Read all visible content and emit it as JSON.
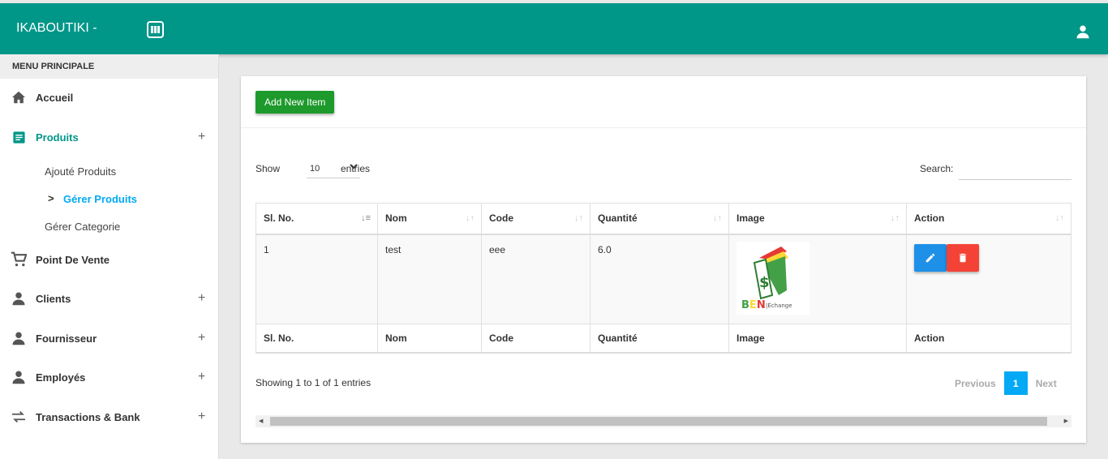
{
  "topbar": {
    "brand": "IKABOUTIKI -",
    "grid_icon": "grid-icon",
    "user_icon": "user-icon",
    "color": "#009688"
  },
  "sidebar": {
    "header": "MENU PRINCIPALE",
    "items": [
      {
        "label": "Accueil",
        "icon": "home-icon"
      },
      {
        "label": "Produits",
        "icon": "document-icon",
        "expand": "+"
      },
      {
        "label": "Point De Vente",
        "icon": "cart-icon"
      },
      {
        "label": "Clients",
        "icon": "person-icon",
        "expand": "+"
      },
      {
        "label": "Fournisseur",
        "icon": "person-icon",
        "expand": "+"
      },
      {
        "label": "Employés",
        "icon": "person-icon",
        "expand": "+"
      },
      {
        "label": "Transactions & Bank",
        "icon": "swap-icon",
        "expand": "+"
      }
    ],
    "subitems": [
      {
        "label": "Ajouté Produits"
      },
      {
        "label": "Gérer Produits",
        "chevron": ">"
      },
      {
        "label": "Gérer Categorie"
      }
    ]
  },
  "card": {
    "add_label": "Add New Item",
    "show_label": "Show",
    "page_size": "10",
    "entries_label": "entries",
    "search_label": "Search:",
    "search_value": "",
    "columns": [
      "Sl. No.",
      "Nom",
      "Code",
      "Quantité",
      "Image",
      "Action"
    ],
    "rows": [
      {
        "sl": "1",
        "nom": "test",
        "code": "eee",
        "quantite": "6.0",
        "image_text": "BEN",
        "image_sub": "Échange"
      }
    ],
    "info": "Showing 1 to 1 of 1 entries",
    "pager": {
      "prev": "Previous",
      "current": "1",
      "next": "Next"
    }
  }
}
